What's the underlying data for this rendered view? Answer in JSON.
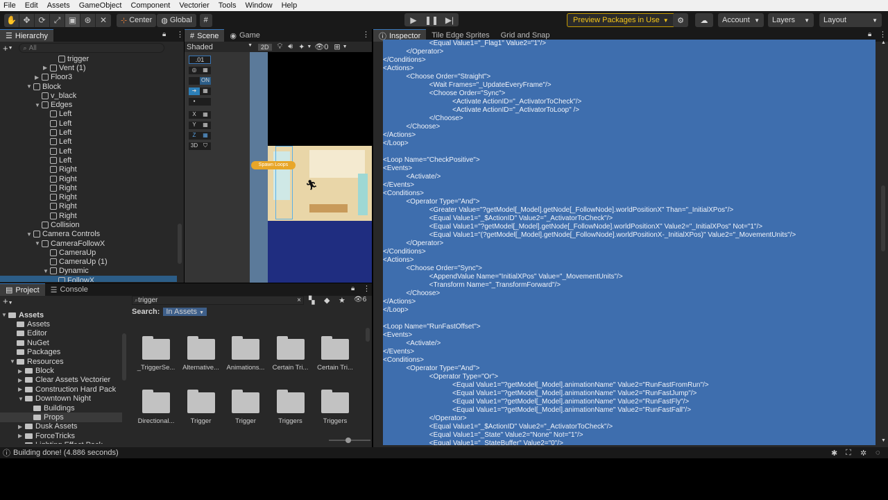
{
  "menu": [
    "File",
    "Edit",
    "Assets",
    "GameObject",
    "Component",
    "Vectorier",
    "Tools",
    "Window",
    "Help"
  ],
  "toolbar": {
    "pivot_label": "Center",
    "space_label": "Global",
    "preview_packages": "Preview Packages in Use",
    "account": "Account",
    "layers": "Layers",
    "layout": "Layout"
  },
  "hierarchy": {
    "title": "Hierarchy",
    "search_placeholder": "All",
    "items": [
      {
        "label": "trigger",
        "indent": 6,
        "arrow": ""
      },
      {
        "label": "Vent (1)",
        "indent": 5,
        "arrow": "▶"
      },
      {
        "label": "Floor3",
        "indent": 4,
        "arrow": "▶"
      },
      {
        "label": "Block",
        "indent": 3,
        "arrow": "▼"
      },
      {
        "label": "v_black",
        "indent": 4,
        "arrow": ""
      },
      {
        "label": "Edges",
        "indent": 4,
        "arrow": "▼"
      },
      {
        "label": "Left",
        "indent": 5,
        "arrow": ""
      },
      {
        "label": "Left",
        "indent": 5,
        "arrow": ""
      },
      {
        "label": "Left",
        "indent": 5,
        "arrow": ""
      },
      {
        "label": "Left",
        "indent": 5,
        "arrow": ""
      },
      {
        "label": "Left",
        "indent": 5,
        "arrow": ""
      },
      {
        "label": "Left",
        "indent": 5,
        "arrow": ""
      },
      {
        "label": "Right",
        "indent": 5,
        "arrow": ""
      },
      {
        "label": "Right",
        "indent": 5,
        "arrow": ""
      },
      {
        "label": "Right",
        "indent": 5,
        "arrow": ""
      },
      {
        "label": "Right",
        "indent": 5,
        "arrow": ""
      },
      {
        "label": "Right",
        "indent": 5,
        "arrow": ""
      },
      {
        "label": "Right",
        "indent": 5,
        "arrow": ""
      },
      {
        "label": "Collision",
        "indent": 4,
        "arrow": ""
      },
      {
        "label": "Camera Controls",
        "indent": 3,
        "arrow": "▼"
      },
      {
        "label": "CameraFollowX",
        "indent": 4,
        "arrow": "▼"
      },
      {
        "label": "CameraUp",
        "indent": 5,
        "arrow": ""
      },
      {
        "label": "CameraUp (1)",
        "indent": 5,
        "arrow": ""
      },
      {
        "label": "Dynamic",
        "indent": 5,
        "arrow": "▼"
      },
      {
        "label": "FollowX",
        "indent": 6,
        "arrow": "",
        "selected": true
      }
    ]
  },
  "scene": {
    "tab_scene": "Scene",
    "tab_game": "Game",
    "shading": "Shaded",
    "mode_2d": "2D",
    "hidden_count": "0",
    "snap_value": ".01",
    "grid_toggle": "ON",
    "axis_x": "X",
    "axis_y": "Y",
    "axis_z": "Z",
    "mode_3d": "3D",
    "spawn_label": "Spawn Loops"
  },
  "project": {
    "tab_project": "Project",
    "tab_console": "Console",
    "search_value": "trigger",
    "search_label": "Search:",
    "search_scope": "In Assets",
    "hidden_count": "6",
    "tree": [
      {
        "label": "Assets",
        "indent": 0,
        "arrow": "▼",
        "bold": true
      },
      {
        "label": "Assets",
        "indent": 1,
        "arrow": ""
      },
      {
        "label": "Editor",
        "indent": 1,
        "arrow": ""
      },
      {
        "label": "NuGet",
        "indent": 1,
        "arrow": ""
      },
      {
        "label": "Packages",
        "indent": 1,
        "arrow": ""
      },
      {
        "label": "Resources",
        "indent": 1,
        "arrow": "▼"
      },
      {
        "label": "Block",
        "indent": 2,
        "arrow": "▶"
      },
      {
        "label": "Clear Assets Vectorier",
        "indent": 2,
        "arrow": "▶"
      },
      {
        "label": "Construction Hard Pack",
        "indent": 2,
        "arrow": "▶"
      },
      {
        "label": "Downtown Night",
        "indent": 2,
        "arrow": "▼"
      },
      {
        "label": "Buildings",
        "indent": 3,
        "arrow": ""
      },
      {
        "label": "Props",
        "indent": 3,
        "arrow": "",
        "selected": true
      },
      {
        "label": "Dusk Assets",
        "indent": 2,
        "arrow": "▶"
      },
      {
        "label": "ForceTricks",
        "indent": 2,
        "arrow": "▶"
      },
      {
        "label": "Lighting Effect Pack",
        "indent": 2,
        "arrow": "▶"
      }
    ],
    "assets": [
      "_TriggerSe...",
      "Alternative...",
      "Animations...",
      "Certain Tri...",
      "Certain Tri...",
      "Directional...",
      "Trigger",
      "Trigger",
      "Triggers",
      "Triggers"
    ]
  },
  "inspector": {
    "tab_inspector": "Inspector",
    "tab_tile": "Tile Edge Sprites",
    "tab_grid": "Grid and Snap",
    "code_lines": [
      "                        <Equal Value1=\"_Flag1\" Value2=\"1\"/>",
      "            </Operator>",
      "</Conditions>",
      "<Actions>",
      "            <Choose Order=\"Straight\">",
      "                        <Wait Frames=\"_UpdateEveryFrame\"/>",
      "                        <Choose Order=\"Sync\">",
      "                                    <Activate ActionID=\"_ActivatorToCheck\"/>",
      "                                    <Activate ActionID=\"_ActivatorToLoop\" />",
      "                        </Choose>",
      "            </Choose>",
      "</Actions>",
      "</Loop>",
      "",
      "<Loop Name=\"CheckPositive\">",
      "<Events>",
      "            <Activate/>",
      "</Events>",
      "<Conditions>",
      "            <Operator Type=\"And\">",
      "                        <Greater Value=\"?getModel[_Model].getNode[_FollowNode].worldPositionX\" Than=\"_InitialXPos\"/>",
      "                        <Equal Value1=\"_$ActionID\" Value2=\"_ActivatorToCheck\"/>",
      "                        <Equal Value1=\"?getModel[_Model].getNode[_FollowNode].worldPositionX\" Value2=\"_InitialXPos\" Not=\"1\"/>",
      "                        <Equal Value1=\"(?getModel[_Model].getNode[_FollowNode].worldPositionX-_InitialXPos)\" Value2=\"_MovementUnits\"/>",
      "            </Operator>",
      "</Conditions>",
      "<Actions>",
      "            <Choose Order=\"Sync\">",
      "                        <AppendValue Name=\"InitialXPos\" Value=\"_MovementUnits\"/>",
      "                        <Transform Name=\"_TransformForward\"/>",
      "            </Choose>",
      "</Actions>",
      "</Loop>",
      "",
      "<Loop Name=\"RunFastOffset\">",
      "<Events>",
      "            <Activate/>",
      "</Events>",
      "<Conditions>",
      "            <Operator Type=\"And\">",
      "                        <Operator Type=\"Or\">",
      "                                    <Equal Value1=\"?getModel[_Model].animationName\" Value2=\"RunFastFromRun\"/>",
      "                                    <Equal Value1=\"?getModel[_Model].animationName\" Value2=\"RunFastJump\"/>",
      "                                    <Equal Value1=\"?getModel[_Model].animationName\" Value2=\"RunFastFly\"/>",
      "                                    <Equal Value1=\"?getModel[_Model].animationName\" Value2=\"RunFastFall\"/>",
      "                        </Operator>",
      "                        <Equal Value1=\"_$ActionID\" Value2=\"_ActivatorToCheck\"/>",
      "                        <Equal Value1=\"_State\" Value2=\"None\" Not=\"1\"/>",
      "                        <Equal Value1=\"_StateBuffer\" Value2=\"0\"/>"
    ]
  },
  "status": {
    "message": "Building done! (4.886 seconds)"
  },
  "colors": {
    "accent": "#3e6eae",
    "selection": "#2c5d87",
    "warning": "#f5c518"
  }
}
